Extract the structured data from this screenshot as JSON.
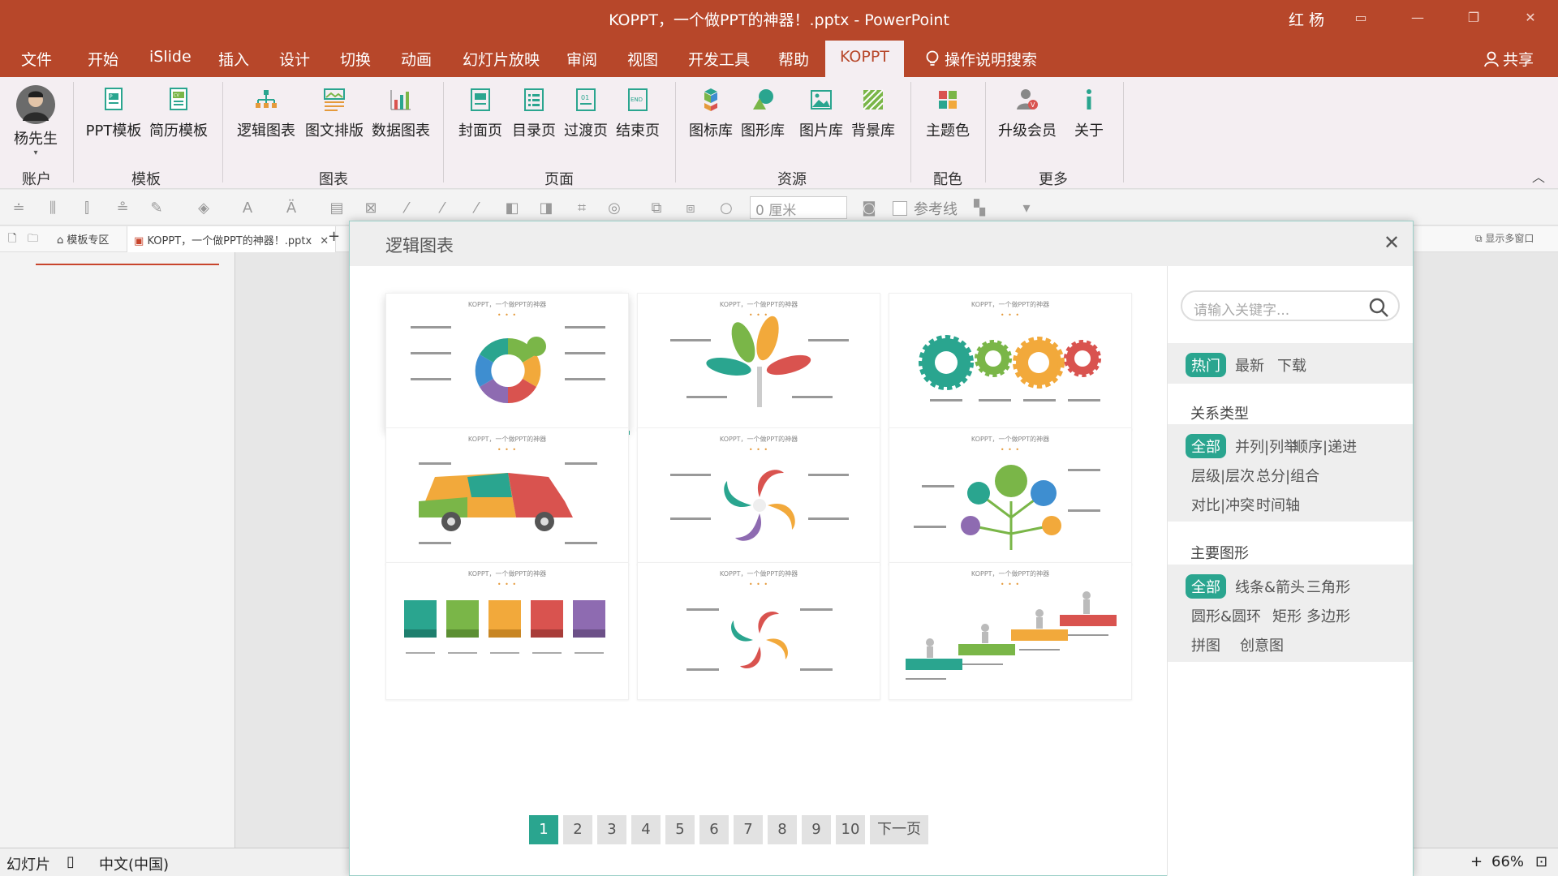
{
  "window": {
    "title": "KOPPT，一个做PPT的神器！.pptx  -  PowerPoint",
    "user": "红 杨"
  },
  "menu": {
    "tabs": [
      "文件",
      "开始",
      "iSlide",
      "插入",
      "设计",
      "切换",
      "动画",
      "幻灯片放映",
      "审阅",
      "视图",
      "开发工具",
      "帮助",
      "KOPPT"
    ],
    "active_tab": "KOPPT",
    "tell_me": "操作说明搜索",
    "share": "共享"
  },
  "ribbon": {
    "account": {
      "name": "杨先生",
      "group": "账户"
    },
    "templates": {
      "items": [
        "PPT模板",
        "简历模板"
      ],
      "group": "模板"
    },
    "charts": {
      "items": [
        "逻辑图表",
        "图文排版",
        "数据图表"
      ],
      "group": "图表"
    },
    "pages": {
      "items": [
        "封面页",
        "目录页",
        "过渡页",
        "结束页"
      ],
      "group": "页面"
    },
    "resources": {
      "items": [
        "图标库",
        "图形库",
        "图片库",
        "背景库"
      ],
      "group": "资源"
    },
    "colors": {
      "items": [
        "主题色"
      ],
      "group": "配色"
    },
    "more": {
      "items": [
        "升级会员",
        "关于"
      ],
      "group": "更多"
    }
  },
  "quick_tools": {
    "size_value": "0 厘米",
    "guide_label": "参考线"
  },
  "doc_tabs": {
    "home": "模板专区",
    "file": "KOPPT，一个做PPT的神器！.pptx",
    "multi_window": "显示多窗口"
  },
  "dialog": {
    "title": "逻辑图表",
    "card_caption": "KOPPT，一个做PPT的神器",
    "pages": [
      "1",
      "2",
      "3",
      "4",
      "5",
      "6",
      "7",
      "8",
      "9",
      "10"
    ],
    "active_page": "1",
    "next_label": "下一页"
  },
  "sidebar": {
    "search_placeholder": "请输入关键字...",
    "sort_tags": [
      "热门",
      "最新",
      "下载"
    ],
    "relation_title": "关系类型",
    "relation_tags": [
      "全部",
      "并列|列举",
      "顺序|递进",
      "层级|层次",
      "总分|组合",
      "对比|冲突",
      "时间轴"
    ],
    "shape_title": "主要图形",
    "shape_tags": [
      "全部",
      "线条&箭头",
      "三角形",
      "圆形&圆环",
      "矩形",
      "多边形",
      "拼图",
      "创意图"
    ]
  },
  "status": {
    "slides": "幻灯片",
    "language": "中文(中国)",
    "zoom": "66%"
  },
  "colors": {
    "brand": "#b7472a",
    "accent": "#2aa58f",
    "green": "#7ab648",
    "orange": "#f2a93b",
    "red": "#d9534f",
    "purple": "#8e6bb1",
    "teal": "#2aa58f",
    "blue": "#3e8ed0"
  }
}
